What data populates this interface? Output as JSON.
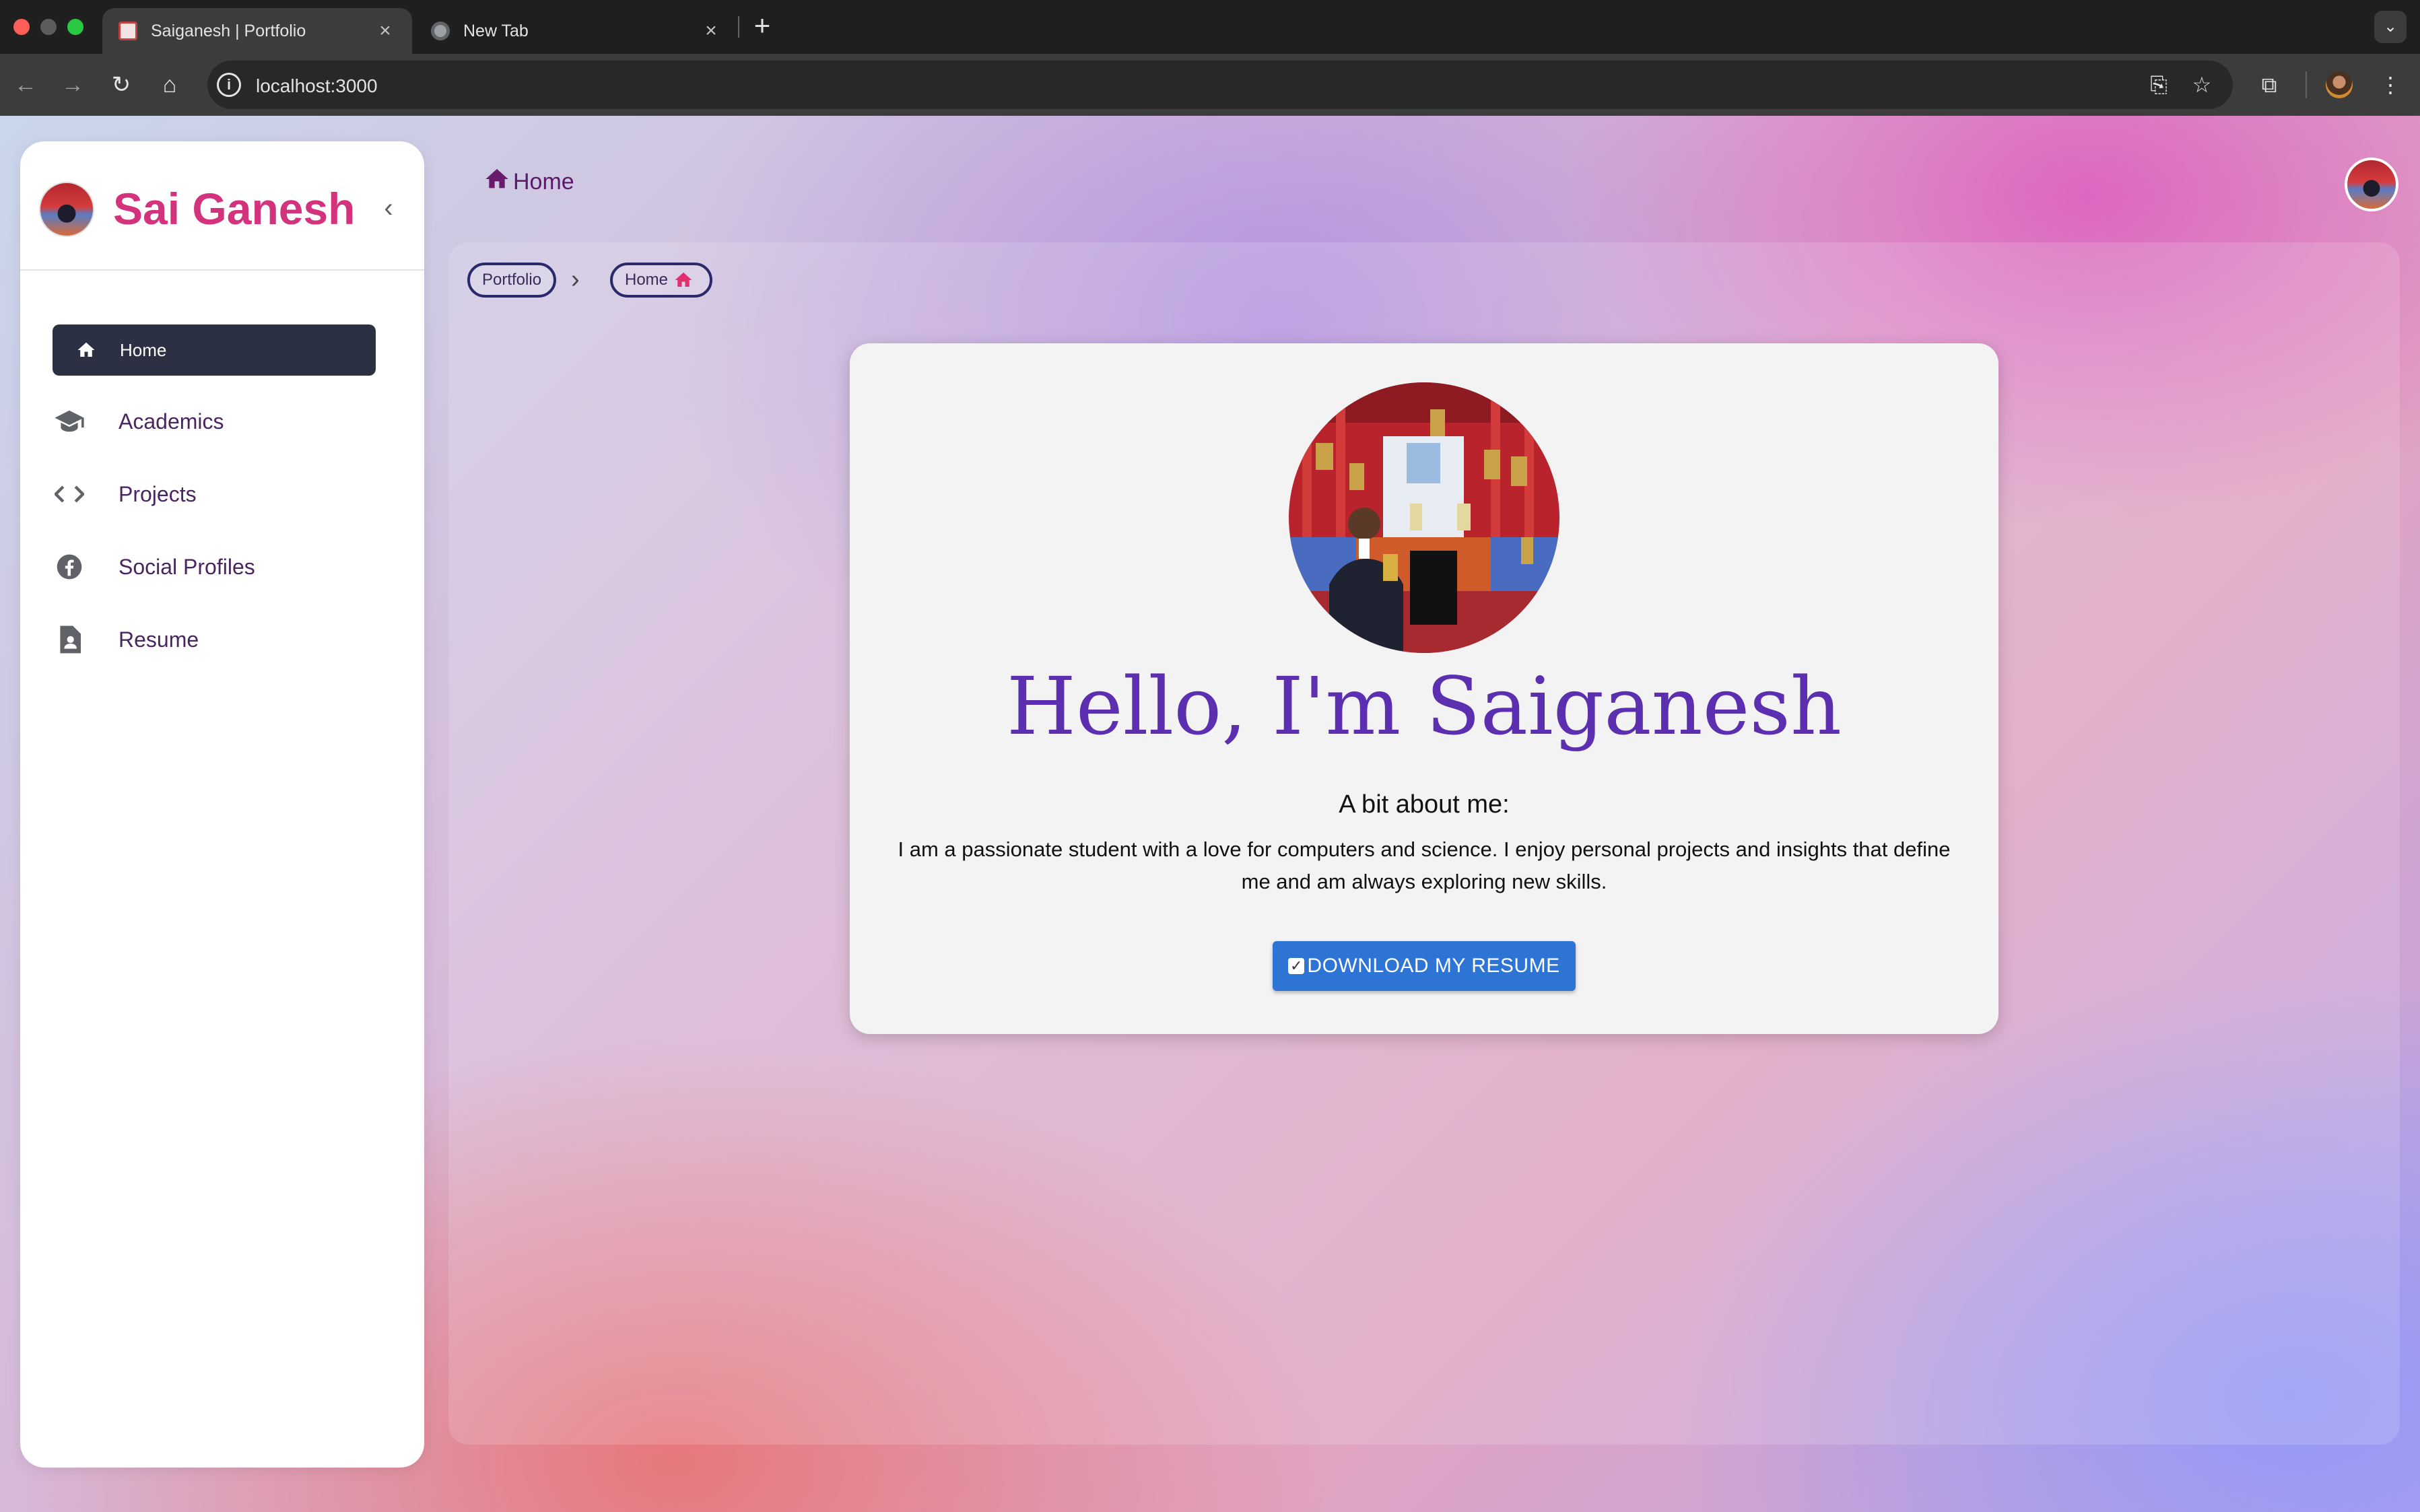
{
  "browser": {
    "tabs": [
      {
        "title": "Saiganesh | Portfolio",
        "active": true
      },
      {
        "title": "New Tab",
        "active": false
      }
    ],
    "url": "localhost:3000"
  },
  "sidebar": {
    "brand": "Sai Ganesh",
    "items": [
      {
        "label": "Home",
        "icon": "home-icon",
        "active": true
      },
      {
        "label": "Academics",
        "icon": "graduation-cap-icon"
      },
      {
        "label": "Projects",
        "icon": "code-icon"
      },
      {
        "label": "Social Profiles",
        "icon": "facebook-icon"
      },
      {
        "label": "Resume",
        "icon": "resume-icon"
      }
    ]
  },
  "header": {
    "title": "Home"
  },
  "breadcrumb": {
    "items": [
      "Portfolio",
      "Home"
    ]
  },
  "card": {
    "greeting": "Hello, I'm Saiganesh",
    "about_title": "A bit about me:",
    "about_text": "I am a passionate student with a love for computers and science. I enjoy personal projects and insights that define me and am always exploring new skills.",
    "button_label": "DOWNLOAD MY RESUME"
  },
  "colors": {
    "brand": "#d3327c",
    "greeting": "#5b2fb0",
    "button": "#2e74d4",
    "active_nav": "#2b3142"
  }
}
